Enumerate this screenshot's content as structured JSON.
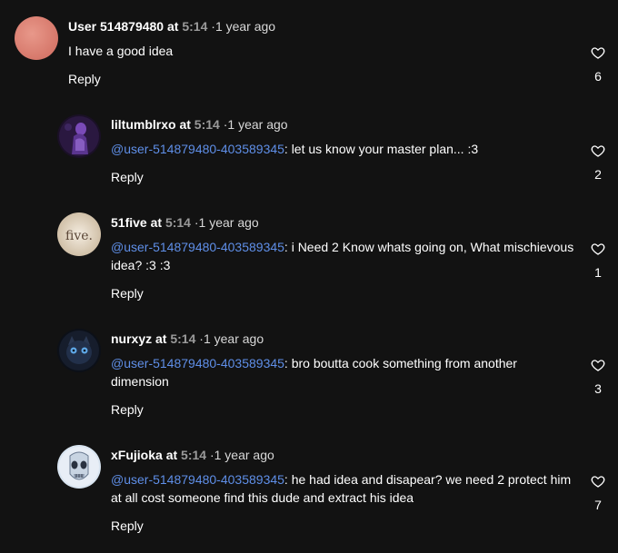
{
  "comments": [
    {
      "username": "User 514879480",
      "at": "at",
      "timestamp": "5:14",
      "separator": "·",
      "age": "1 year ago",
      "mention": "",
      "text": "I have a good idea",
      "reply_label": "Reply",
      "likes": "6",
      "avatar_icon": "default-avatar-icon"
    },
    {
      "username": "liltumblrxo",
      "at": "at",
      "timestamp": "5:14",
      "separator": "·",
      "age": "1 year ago",
      "mention": "@user-514879480-403589345",
      "text": ": let us know your master plan... :3",
      "reply_label": "Reply",
      "likes": "2",
      "avatar_icon": "purple-figure-avatar"
    },
    {
      "username": "51five",
      "at": "at",
      "timestamp": "5:14",
      "separator": "·",
      "age": "1 year ago",
      "mention": "@user-514879480-403589345",
      "text": ": i Need 2 Know whats going on, What mischievous idea? :3 :3",
      "reply_label": "Reply",
      "likes": "1",
      "avatar_icon": "five-logo-avatar",
      "avatar_text": "five."
    },
    {
      "username": "nurxyz",
      "at": "at",
      "timestamp": "5:14",
      "separator": "·",
      "age": "1 year ago",
      "mention": "@user-514879480-403589345",
      "text": ": bro boutta cook something from another dimension",
      "reply_label": "Reply",
      "likes": "3",
      "avatar_icon": "dark-cat-avatar"
    },
    {
      "username": "xFujioka",
      "at": "at",
      "timestamp": "5:14",
      "separator": "·",
      "age": "1 year ago",
      "mention": "@user-514879480-403589345",
      "text": ": he had idea and disapear? we need 2 protect him at all cost someone find this dude and extract his idea",
      "reply_label": "Reply",
      "likes": "7",
      "avatar_icon": "mask-avatar"
    }
  ],
  "colors": {
    "background": "#121212",
    "mention": "#5f8fe8",
    "timestamp": "#9a9a9a",
    "default_avatar": "#e0857a"
  },
  "icons": {
    "like": "heart-outline-icon"
  }
}
